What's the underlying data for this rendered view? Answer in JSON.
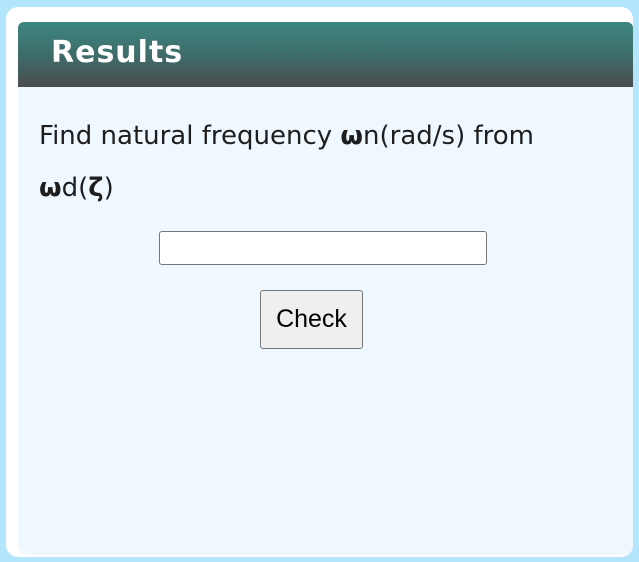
{
  "panel": {
    "title": "Results"
  },
  "question": {
    "prefix": "Find natural frequency ",
    "omega_n_symbol": "ω",
    "omega_n_suffix": "n(rad/s) from",
    "omega_d_symbol": "ω",
    "omega_d_mid": "d(",
    "zeta_symbol": "ζ",
    "close": ")"
  },
  "answer": {
    "value": "",
    "placeholder": ""
  },
  "check_button": {
    "label": "Check"
  },
  "colors": {
    "page_background": "#b3e5fc",
    "panel_background": "#eef8fe",
    "header_gradient_top": "#3d8781",
    "header_gradient_bottom": "#4a4c4d"
  }
}
